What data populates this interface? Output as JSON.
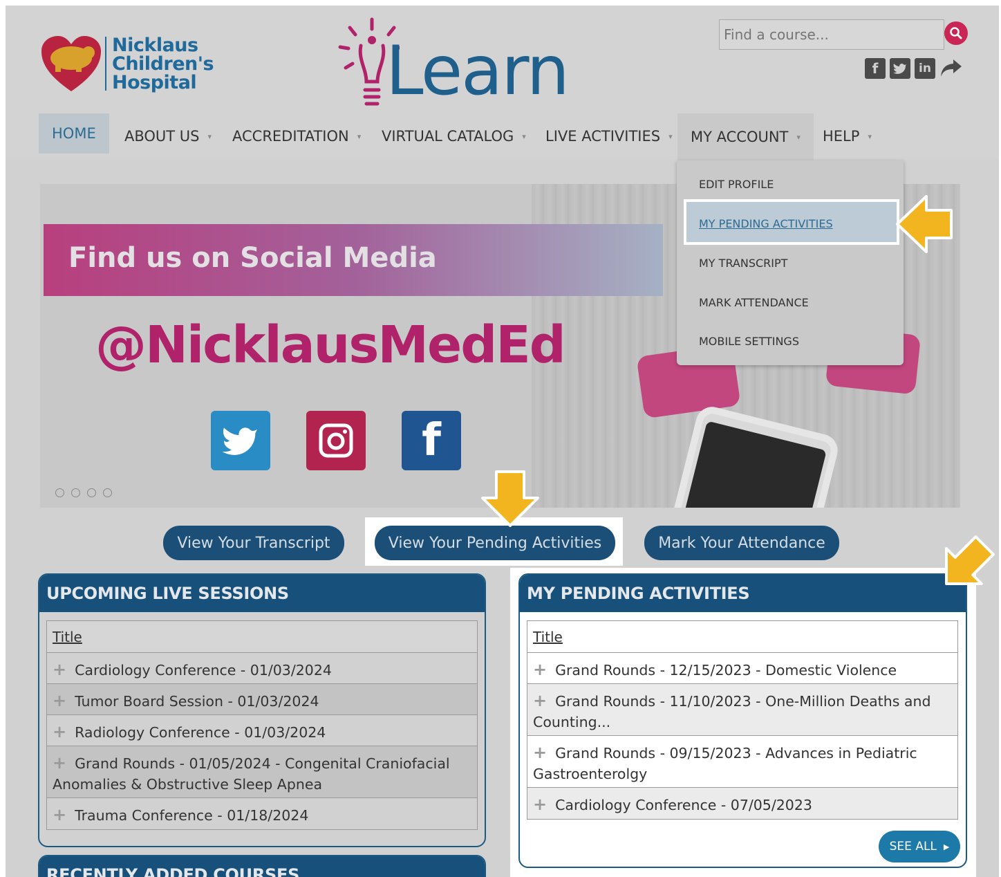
{
  "header": {
    "logo_lines": [
      "Nicklaus",
      "Children's",
      "Hospital"
    ],
    "brand_name": "Learn",
    "search_placeholder": "Find a course...",
    "social_icons": [
      "facebook-icon",
      "twitter-icon",
      "linkedin-icon",
      "share-icon"
    ]
  },
  "nav": {
    "items": [
      {
        "label": "HOME",
        "has_caret": false
      },
      {
        "label": "ABOUT US",
        "has_caret": true
      },
      {
        "label": "ACCREDITATION",
        "has_caret": true
      },
      {
        "label": "VIRTUAL CATALOG",
        "has_caret": true
      },
      {
        "label": "LIVE ACTIVITIES",
        "has_caret": true
      },
      {
        "label": "MY ACCOUNT",
        "has_caret": true
      },
      {
        "label": "HELP",
        "has_caret": true
      }
    ],
    "caret": "▾"
  },
  "dropdown": {
    "items": [
      "EDIT PROFILE",
      "MY PENDING ACTIVITIES",
      "MY TRANSCRIPT",
      "MARK ATTENDANCE",
      "MOBILE SETTINGS"
    ],
    "active_index": 1
  },
  "banner": {
    "headline": "Find us on Social Media",
    "handle": "@NicklausMedEd",
    "slide_count": 4
  },
  "actions": {
    "transcript": "View Your Transcript",
    "pending": "View Your Pending Activities",
    "attendance": "Mark Your Attendance"
  },
  "upcoming": {
    "title": "UPCOMING LIVE SESSIONS",
    "column": "Title",
    "rows": [
      "Cardiology Conference - 01/03/2024",
      "Tumor Board Session - 01/03/2024",
      "Radiology Conference - 01/03/2024",
      "Grand Rounds - 01/05/2024 - Congenital Craniofacial Anomalies & Obstructive Sleep Apnea",
      "Trauma Conference - 01/18/2024"
    ]
  },
  "pending": {
    "title": "MY PENDING ACTIVITIES",
    "column": "Title",
    "rows": [
      "Grand Rounds - 12/15/2023 - Domestic Violence",
      "Grand Rounds - 11/10/2023 - One-Million Deaths and Counting...",
      "Grand Rounds - 09/15/2023 - Advances in Pediatric Gastroenterolgy",
      "Cardiology Conference - 07/05/2023"
    ],
    "see_all": "SEE ALL"
  },
  "recent": {
    "title": "RECENTLY ADDED COURSES"
  },
  "colors": {
    "navy": "#17507a",
    "magenta": "#b0236a",
    "arrow": "#f2b51f",
    "search": "#c92655"
  }
}
